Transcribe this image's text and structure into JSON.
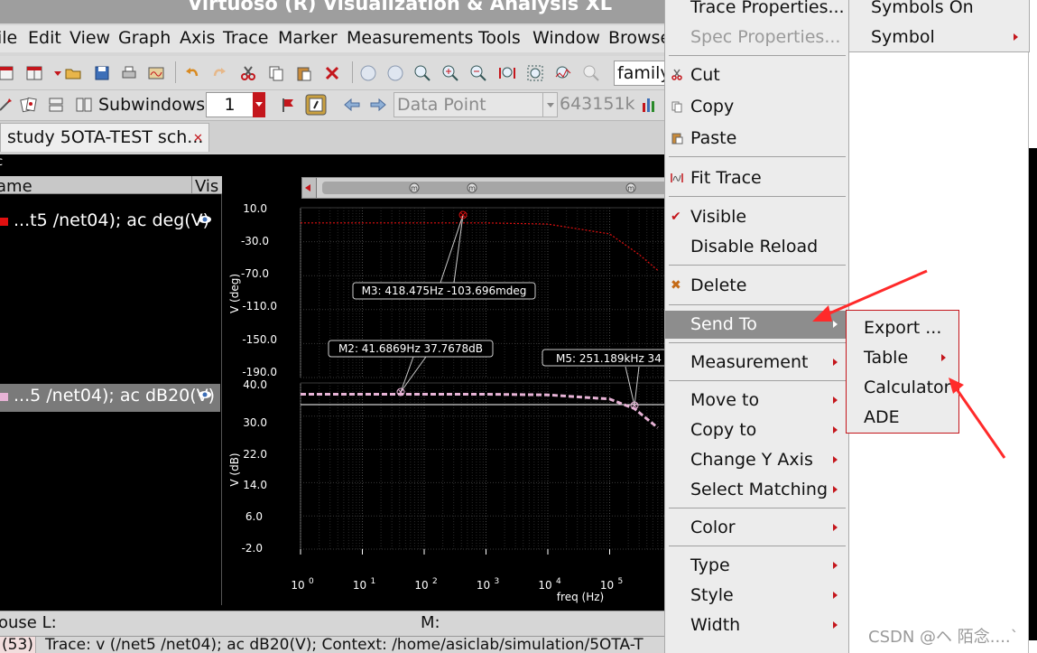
{
  "window": {
    "title": "Virtuoso (R) Visualization & Analysis XL"
  },
  "menubar": [
    "ile",
    "Edit",
    "View",
    "Graph",
    "Axis",
    "Trace",
    "Marker",
    "Measurements",
    "Tools",
    "Window",
    "Browse"
  ],
  "toolbar": {
    "family_value": "family",
    "subwindows_label": "Subwindows:",
    "subwindows_value": "1",
    "datapoint_value": "Data Point",
    "coord_value": "643151k"
  },
  "tab": {
    "label": "study 5OTA-TEST sch..."
  },
  "trace_panel": {
    "header_name": "ame",
    "header_vis": "Vis",
    "corner_label": "c",
    "traces": [
      {
        "label": "...t5 /net04); ac deg(V)",
        "color": "#e01010",
        "selected": false
      },
      {
        "label": "...5 /net04); ac dB20(V)",
        "color": "#e7b3d6",
        "selected": true
      }
    ]
  },
  "plot_top": {
    "ylabel": "V (deg)",
    "yticks": [
      "10.0",
      "-30.0",
      "-70.0",
      "-110.0",
      "-150.0",
      "-190.0"
    ],
    "marker_label": "M3: 418.475Hz -103.696mdeg"
  },
  "plot_bottom": {
    "ylabel": "V (dB)",
    "yticks": [
      "40.0",
      "30.0",
      "22.0",
      "14.0",
      "6.0",
      "-2.0"
    ],
    "marker2_label": "M2: 41.6869Hz 37.7678dB",
    "marker5_label": "M5: 251.189kHz 34"
  },
  "x_axis": {
    "xlabel": "freq (Hz)",
    "ticks": [
      "0",
      "1",
      "2",
      "3",
      "4",
      "5"
    ],
    "base": "10"
  },
  "chart_data": [
    {
      "type": "line",
      "title": "",
      "ylabel": "V (deg)",
      "xlabel": "freq (Hz)",
      "xscale": "log",
      "ylim": [
        -190,
        10
      ],
      "series": [
        {
          "name": "ac deg(V)",
          "color": "#e01010",
          "x": [
            1,
            10,
            100,
            1000,
            10000,
            100000,
            300000,
            600000
          ],
          "values": [
            -0.1,
            -0.1,
            -0.1,
            -0.1,
            -1.5,
            -14,
            -40,
            -60
          ]
        }
      ],
      "markers": [
        {
          "label": "M3",
          "x": 418.475,
          "y": -0.103696
        }
      ]
    },
    {
      "type": "line",
      "title": "",
      "ylabel": "V (dB)",
      "xlabel": "freq (Hz)",
      "xscale": "log",
      "ylim": [
        -2,
        40
      ],
      "series": [
        {
          "name": "ac dB20(V)",
          "color": "#e7b3d6",
          "x": [
            1,
            10,
            100,
            1000,
            10000,
            100000,
            251189,
            600000
          ],
          "values": [
            37.77,
            37.77,
            37.77,
            37.77,
            37.6,
            36.5,
            34,
            29
          ]
        }
      ],
      "markers": [
        {
          "label": "M2",
          "x": 41.6869,
          "y": 37.7678
        },
        {
          "label": "M5",
          "x": 251189,
          "y": 34
        }
      ]
    }
  ],
  "status": {
    "mouse_label": "ouse L:",
    "m_label": "M:",
    "count": "(53)",
    "message": "Trace: v (/net5 /net04); ac dB20(V); Context: /home/asiclab/simulation/5OTA-T"
  },
  "context_menu": {
    "items": [
      {
        "label": "Trace Properties...",
        "disabled": false,
        "icon": "",
        "submenu": false
      },
      {
        "label": "Spec Properties...",
        "disabled": true,
        "icon": "",
        "submenu": false
      },
      {
        "label": "Cut",
        "disabled": false,
        "icon": "scissors-icon",
        "submenu": false
      },
      {
        "label": "Copy",
        "disabled": false,
        "icon": "copy-icon",
        "submenu": false
      },
      {
        "label": "Paste",
        "disabled": false,
        "icon": "paste-icon",
        "submenu": false
      },
      {
        "label": "Fit Trace",
        "disabled": false,
        "icon": "fit-icon",
        "submenu": false
      },
      {
        "label": "Visible",
        "disabled": false,
        "icon": "check-icon",
        "submenu": false
      },
      {
        "label": "Disable Reload",
        "disabled": false,
        "icon": "",
        "submenu": false
      },
      {
        "label": "Delete",
        "disabled": false,
        "icon": "delete-icon",
        "submenu": false
      },
      {
        "label": "Send To",
        "disabled": false,
        "icon": "",
        "submenu": true,
        "active": true
      },
      {
        "label": "Measurement",
        "disabled": false,
        "icon": "",
        "submenu": true
      },
      {
        "label": "Move to",
        "disabled": false,
        "icon": "",
        "submenu": true
      },
      {
        "label": "Copy to",
        "disabled": false,
        "icon": "",
        "submenu": true
      },
      {
        "label": "Change Y Axis",
        "disabled": false,
        "icon": "",
        "submenu": true
      },
      {
        "label": "Select Matching",
        "disabled": false,
        "icon": "",
        "submenu": true
      },
      {
        "label": "Color",
        "disabled": false,
        "icon": "",
        "submenu": true
      },
      {
        "label": "Type",
        "disabled": false,
        "icon": "",
        "submenu": true
      },
      {
        "label": "Style",
        "disabled": false,
        "icon": "",
        "submenu": true
      },
      {
        "label": "Width",
        "disabled": false,
        "icon": "",
        "submenu": true
      }
    ]
  },
  "symbol_submenu": {
    "symbols_on": "Symbols On",
    "symbol": "Symbol"
  },
  "sendto_submenu": {
    "items": [
      {
        "label": "Export ...",
        "submenu": false
      },
      {
        "label": "Table",
        "submenu": true
      },
      {
        "label": "Calculator",
        "submenu": false
      },
      {
        "label": "ADE",
        "submenu": false
      }
    ]
  },
  "watermark": "CSDN @ヘ 陌念....`",
  "colors": {
    "accent": "#c4161c",
    "annotation_arrow": "#ff2a2a",
    "menu_active": "#8d8d8d"
  }
}
